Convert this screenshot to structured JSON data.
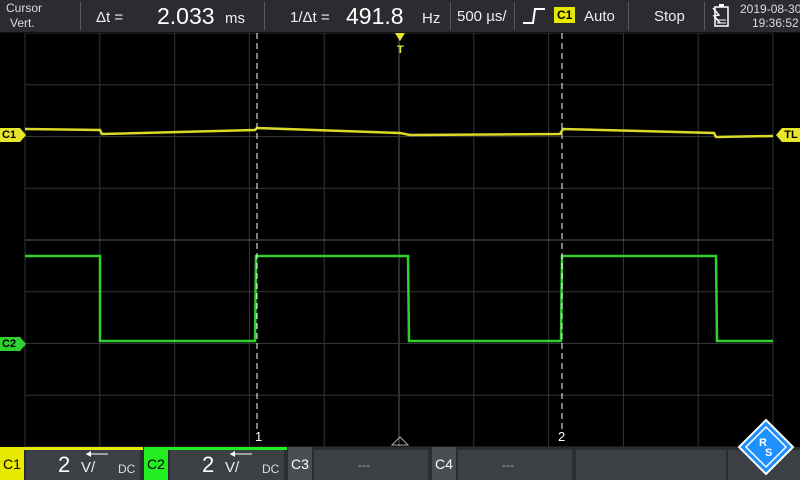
{
  "topbar": {
    "mode_label": "Cursor",
    "mode_sub": "Vert.",
    "delta_t_label": "Δt =",
    "delta_t_value": "2.033",
    "delta_t_unit": "ms",
    "inv_delta_t_label": "1/Δt =",
    "inv_delta_t_value": "491.8",
    "inv_delta_t_unit": "Hz",
    "timebase": "500 µs/",
    "trigger_channel": "C1",
    "trigger_mode": "Auto",
    "run_state": "Stop",
    "date": "2019-08-30",
    "time": "19:36:52"
  },
  "markers": {
    "c1_left": "C1",
    "c2_left": "C2",
    "trigger_level": "TL",
    "trigger_pos": "T",
    "cursor1": "1",
    "cursor2": "2"
  },
  "channels": [
    {
      "label": "C1",
      "scale": "2",
      "unit": "V/",
      "coupling": "DC",
      "color": "#e8e800"
    },
    {
      "label": "C2",
      "scale": "2",
      "unit": "V/",
      "coupling": "DC",
      "color": "#22ee22"
    },
    {
      "label": "C3",
      "scale": "---",
      "color": "#555555"
    },
    {
      "label": "C4",
      "scale": "---",
      "color": "#555555"
    }
  ],
  "colors": {
    "c1": "#e6e62a",
    "c2": "#2fd12f",
    "grid": "#3c3c3c",
    "brand": "#1e90ff"
  }
}
